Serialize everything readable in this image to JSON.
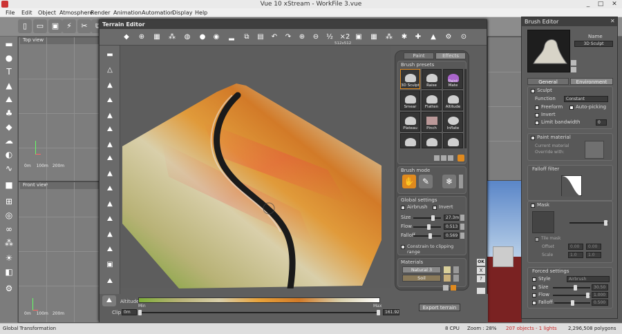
{
  "app": {
    "title": "Vue 10 xStream - WorkFile 3.vue",
    "window_controls": [
      "_",
      "□",
      "✕"
    ],
    "menu": [
      "File",
      "Edit",
      "Object",
      "Atmosphere",
      "Render",
      "Animation",
      "Automation",
      "Display",
      "Help"
    ]
  },
  "viewports": {
    "top_label": "Top view",
    "front_label": "Front view",
    "scale_ticks": [
      "0m",
      "100m",
      "200m"
    ]
  },
  "terrain_editor": {
    "title": "Terrain Editor",
    "resolution": "512x512",
    "paint_tab": "Paint",
    "effects_tab": "Effects",
    "brush_presets_label": "Brush presets",
    "presets": [
      "3D Sculpt",
      "Raise",
      "Paint Mate",
      "Smear",
      "Flatten",
      "Altitude",
      "Plateau",
      "Pinch",
      "Inflate"
    ],
    "brush_mode_label": "Brush mode",
    "global_settings": {
      "label": "Global settings",
      "airbrush": "Airbrush",
      "invert": "Invert",
      "size_label": "Size",
      "size_value": "27.3m",
      "flow_label": "Flow",
      "flow_value": "0.513",
      "falloff_label": "Falloff",
      "falloff_value": "0.569",
      "constrain": "Constrain to clipping range"
    },
    "materials": {
      "label": "Materials",
      "mat1": "Natural 3",
      "mat2": "Soil"
    },
    "altitudes_label": "Altitudes",
    "min_label": "Min",
    "max_label": "Max",
    "clip_label": "Clip",
    "clip_low": "0m",
    "clip_high": "161.92",
    "export_button": "Export terrain",
    "ok_button": "OK",
    "cancel_button": "X",
    "help_button": "?"
  },
  "brush_editor": {
    "title": "Brush Editor",
    "name_label": "Name",
    "name_value": "3D Sculpt",
    "tab_general": "General",
    "tab_environment": "Environment",
    "sculpt": "Sculpt",
    "function_label": "Function",
    "function_value": "Constant",
    "freeform": "Freeform",
    "auto_picking": "Auto-picking",
    "invert": "Invert",
    "limit_bandwidth": "Limit bandwidth",
    "limit_value": "0",
    "paint_material": "Paint material",
    "current_material": "Current material",
    "override_with": "Override with:",
    "falloff_filter": "Falloff filter",
    "mask": "Mask",
    "tile_mask": "Tile mask",
    "offset_label": "Offset",
    "offset_x": "0.00",
    "offset_y": "0.00",
    "scale_label": "Scale",
    "scale_x": "1.0",
    "scale_y": "1.0",
    "forced_settings": "Forced settings",
    "style_label": "Style",
    "style_value": "Airbrush",
    "size_label": "Size",
    "size_value": "30.50",
    "flow_label": "Flow",
    "flow_value": "1.000",
    "falloff_label": "Falloff",
    "falloff_value": "0.500"
  },
  "status": {
    "left": "Global Transformation",
    "cpu": "8 CPU",
    "zoom": "Zoom : 28%",
    "objects": "207 objects - 1 lights",
    "polygons": "2,296,508 polygons"
  },
  "colors": {
    "accent_orange": "#e08a1e",
    "gradient": [
      "#7fae3a",
      "#d9cf9a",
      "#e8a23a",
      "#d9d9d9"
    ]
  }
}
